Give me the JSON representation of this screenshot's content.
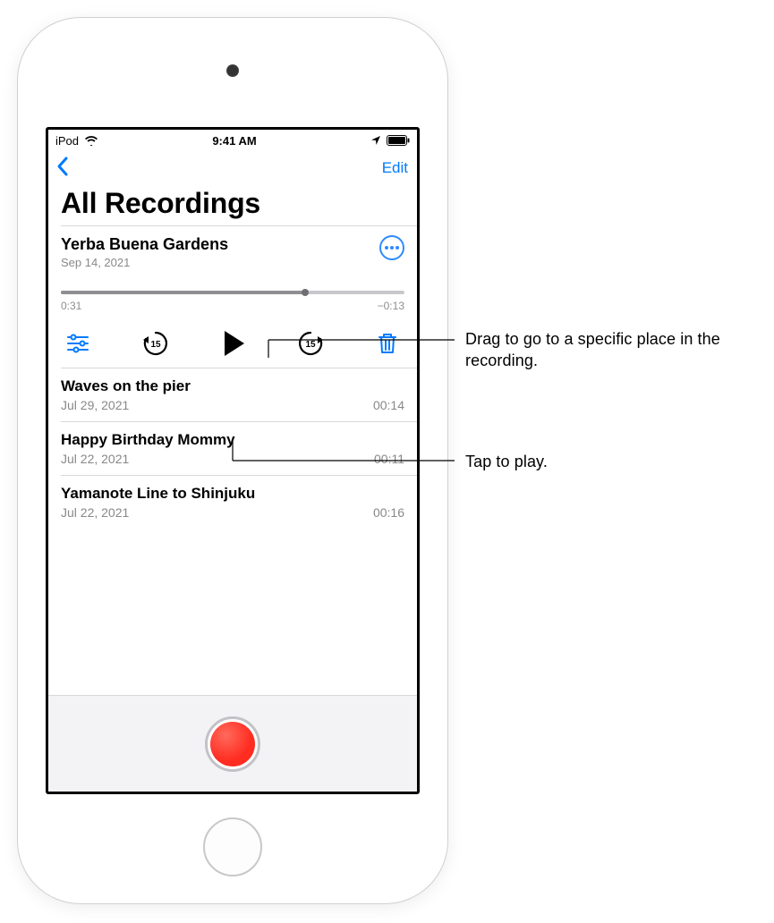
{
  "status": {
    "carrier": "iPod",
    "time": "9:41 AM"
  },
  "nav": {
    "edit": "Edit"
  },
  "pageTitle": "All Recordings",
  "expanded": {
    "title": "Yerba Buena Gardens",
    "date": "Sep 14, 2021",
    "progress": 0.71,
    "elapsed": "0:31",
    "remaining": "−0:13"
  },
  "recordings": [
    {
      "title": "Waves on the pier",
      "date": "Jul 29, 2021",
      "duration": "00:14"
    },
    {
      "title": "Happy Birthday Mommy",
      "date": "Jul 22, 2021",
      "duration": "00:11"
    },
    {
      "title": "Yamanote Line to Shinjuku",
      "date": "Jul 22, 2021",
      "duration": "00:16"
    }
  ],
  "colors": {
    "tint": "#007aff",
    "recordRed": "#ff3b30"
  },
  "callouts": {
    "scrubber": "Drag to go to a specific place in the recording.",
    "play": "Tap to play."
  }
}
